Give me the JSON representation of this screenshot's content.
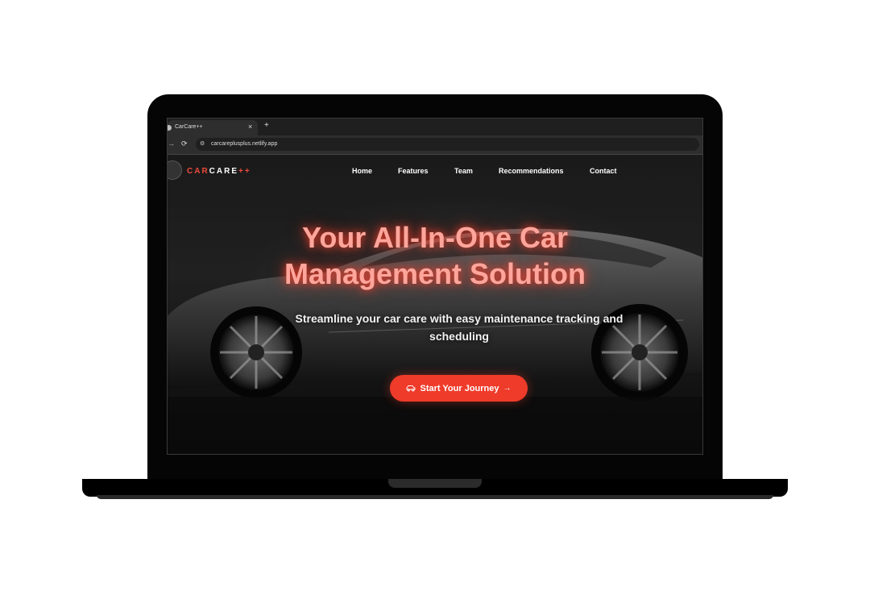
{
  "browser": {
    "tab_title": "CarCare++",
    "tab_close": "×",
    "new_tab": "+",
    "forward_icon": "→",
    "reload_icon": "⟳",
    "site_info_icon": "⚙",
    "url": "carcareplusplus.netlify.app"
  },
  "site": {
    "logo": {
      "part1": "CAR",
      "part2": "CARE",
      "part3": "++"
    },
    "nav": [
      "Home",
      "Features",
      "Team",
      "Recommendations",
      "Contact"
    ],
    "hero": {
      "title_line1": "Your All-In-One Car",
      "title_line2": "Management Solution",
      "subtitle": "Streamline your car care with easy maintenance tracking and scheduling",
      "cta_label": "Start Your Journey",
      "cta_icon": "car-icon",
      "cta_arrow": "→"
    }
  },
  "colors": {
    "accent": "#ef3b2a",
    "title_glow": "#ffa59b",
    "background": "#151515"
  }
}
